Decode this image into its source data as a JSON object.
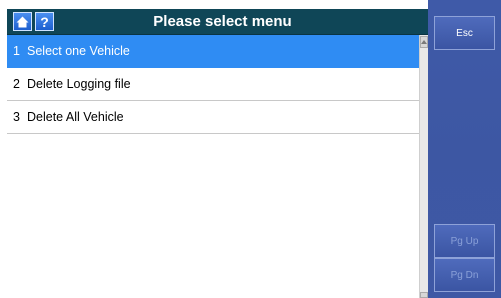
{
  "header": {
    "title": "Please select menu",
    "help_glyph": "?",
    "home_icon": "home-icon",
    "help_icon": "help-icon"
  },
  "menu": {
    "items": [
      {
        "num": "1",
        "label": "Select one Vehicle",
        "selected": true
      },
      {
        "num": "2",
        "label": "Delete Logging file",
        "selected": false
      },
      {
        "num": "3",
        "label": "Delete All Vehicle",
        "selected": false
      }
    ]
  },
  "sidebar": {
    "esc_label": "Esc",
    "pgup_label": "Pg Up",
    "pgdn_label": "Pg Dn"
  },
  "colors": {
    "titlebar": "#0f4657",
    "selected_row": "#2f8cf3",
    "sidebar": "#3e58a5"
  }
}
